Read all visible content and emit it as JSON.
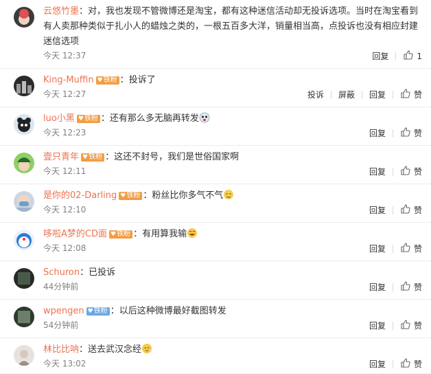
{
  "comments": [
    {
      "user": "云悠竹墨",
      "badge": null,
      "text": "对，我也发现不管微博还是淘宝，都有这种迷信活动却无投诉选项。当时在淘宝看到有人卖那种类似于扎小人的蜡烛之类的，一根五百多大洋，销量相当高，点投诉也没有相应封建迷信选项",
      "time": "今天 12:37",
      "actions": [
        "回复"
      ],
      "like_count": "1",
      "emoji": null
    },
    {
      "user": "King-Muffin",
      "badge": {
        "label": "铁粉",
        "type": "iron"
      },
      "text": "投诉了",
      "time": "今天 12:27",
      "actions": [
        "投诉",
        "屏蔽",
        "回复"
      ],
      "like_label": "赞",
      "emoji": null
    },
    {
      "user": "luo小黑",
      "badge": {
        "label": "铁粉",
        "type": "iron"
      },
      "text": "还有那么多无脑再转发",
      "time": "今天 12:23",
      "actions": [
        "回复"
      ],
      "like_label": "赞",
      "emoji": "scared-face"
    },
    {
      "user": "壹只青年",
      "badge": {
        "label": "铁粉",
        "type": "iron"
      },
      "text": "这还不封号，我们是世俗国家啊",
      "time": "今天 12:11",
      "actions": [
        "回复"
      ],
      "like_label": "赞",
      "emoji": null
    },
    {
      "user": "是你的02-Darling",
      "badge": {
        "label": "铁粉",
        "type": "iron"
      },
      "text": "粉丝比你多气不气",
      "time": "今天 12:10",
      "actions": [
        "回复"
      ],
      "like_label": "赞",
      "emoji": "cheeky-face"
    },
    {
      "user": "哆啦A梦的CD面",
      "badge": {
        "label": "铁粉",
        "type": "iron"
      },
      "text": "有用算我输",
      "time": "今天 12:08",
      "actions": [
        "回复"
      ],
      "like_label": "赞",
      "emoji": "laughing-face"
    },
    {
      "user": "Schuron",
      "badge": null,
      "text": "已投诉",
      "time": "44分钟前",
      "actions": [
        "回复"
      ],
      "like_label": "赞",
      "emoji": null
    },
    {
      "user": "wpengen",
      "badge": {
        "label": "铁粉",
        "type": "blue"
      },
      "text": "以后这种微博最好截图转发",
      "time": "54分钟前",
      "actions": [
        "回复"
      ],
      "like_label": "赞",
      "emoji": null
    },
    {
      "user": "林比比呐",
      "badge": null,
      "text": "送去武汉念经",
      "time": "今天 13:02",
      "actions": [
        "回复"
      ],
      "like_label": "赞",
      "emoji": "praying-face"
    }
  ],
  "colors": {
    "username": "#eb7350",
    "iron_badge": "#f29d45",
    "blue_badge": "#6ba8e3"
  }
}
